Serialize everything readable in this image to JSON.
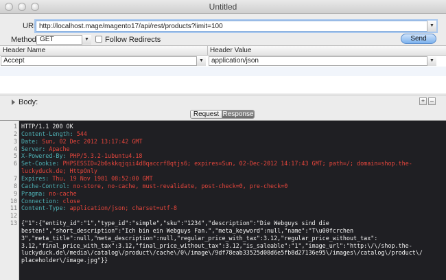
{
  "window": {
    "title": "Untitled"
  },
  "request": {
    "url_label": "URL:",
    "url": "http://localhost.mage/magento17/api/rest/products?limit=100",
    "method_label": "Method:",
    "method": "GET",
    "follow_redirects_label": "Follow Redirects",
    "send_label": "Send"
  },
  "headers_table": {
    "col_name": "Header Name",
    "col_value": "Header Value",
    "rows": [
      {
        "name": "Accept",
        "value": "application/json"
      }
    ]
  },
  "body_section": {
    "label": "Body:",
    "add_label": "+",
    "remove_label": "–"
  },
  "tabs": {
    "request": "Request",
    "response": "Response",
    "active": "Response"
  },
  "response_lines": [
    {
      "n": "1",
      "parts": [
        {
          "t": "HTTP/1.1 200 OK",
          "c": "w"
        }
      ]
    },
    {
      "n": "2",
      "parts": [
        {
          "t": "Content-Length: ",
          "c": "k"
        },
        {
          "t": "544",
          "c": "v"
        }
      ]
    },
    {
      "n": "3",
      "parts": [
        {
          "t": "Date: ",
          "c": "k"
        },
        {
          "t": "Sun, 02 Dec 2012 13:17:42 GMT",
          "c": "v"
        }
      ]
    },
    {
      "n": "4",
      "parts": [
        {
          "t": "Server: ",
          "c": "k"
        },
        {
          "t": "Apache",
          "c": "v"
        }
      ]
    },
    {
      "n": "5",
      "parts": [
        {
          "t": "X-Powered-By: ",
          "c": "k"
        },
        {
          "t": "PHP/5.3.2-1ubuntu4.18",
          "c": "v"
        }
      ]
    },
    {
      "n": "6",
      "parts": [
        {
          "t": "Set-Cookie: ",
          "c": "k"
        },
        {
          "t": "PHPSESSID=2b6skkqjqii4d8qaccrf8qtjs6; expires=Sun, 02-Dec-2012 14:17:43 GMT; path=/; domain=shop.the-",
          "c": "v"
        }
      ]
    },
    {
      "n": "",
      "parts": [
        {
          "t": "luckyduck.de; HttpOnly",
          "c": "v"
        }
      ]
    },
    {
      "n": "7",
      "parts": [
        {
          "t": "Expires: ",
          "c": "k"
        },
        {
          "t": "Thu, 19 Nov 1981 08:52:00 GMT",
          "c": "v"
        }
      ]
    },
    {
      "n": "8",
      "parts": [
        {
          "t": "Cache-Control: ",
          "c": "k"
        },
        {
          "t": "no-store, no-cache, must-revalidate, post-check=0, pre-check=0",
          "c": "v"
        }
      ]
    },
    {
      "n": "9",
      "parts": [
        {
          "t": "Pragma: ",
          "c": "k"
        },
        {
          "t": "no-cache",
          "c": "v"
        }
      ]
    },
    {
      "n": "10",
      "parts": [
        {
          "t": "Connection: ",
          "c": "k"
        },
        {
          "t": "close",
          "c": "v"
        }
      ]
    },
    {
      "n": "11",
      "parts": [
        {
          "t": "Content-Type: ",
          "c": "k"
        },
        {
          "t": "application/json; charset=utf-8",
          "c": "v"
        }
      ]
    },
    {
      "n": "12",
      "parts": [
        {
          "t": "",
          "c": "w"
        }
      ]
    },
    {
      "n": "13",
      "parts": [
        {
          "t": "{\"1\":{\"entity_id\":\"1\",\"type_id\":\"simple\",\"sku\":\"1234\",\"description\":\"Die Webguys sind die",
          "c": "s"
        }
      ]
    },
    {
      "n": "",
      "parts": [
        {
          "t": "besten!\",\"short_description\":\"Ich bin ein Webguys Fan.\",\"meta_keyword\":null,\"name\":\"T\\u00fcrchen",
          "c": "s"
        }
      ]
    },
    {
      "n": "",
      "parts": [
        {
          "t": "3\",\"meta_title\":null,\"meta_description\":null,\"regular_price_with_tax\":3.12,\"regular_price_without_tax\":",
          "c": "s"
        }
      ]
    },
    {
      "n": "",
      "parts": [
        {
          "t": "3.12,\"final_price_with_tax\":3.12,\"final_price_without_tax\":3.12,\"is_saleable\":\"1\",\"image_url\":\"http:\\/\\/shop.the-",
          "c": "s"
        }
      ]
    },
    {
      "n": "",
      "parts": [
        {
          "t": "luckyduck.de\\/media\\/catalog\\/product\\/cache\\/0\\/image\\/9df78eab33525d08d6e5fb8d27136e95\\/images\\/catalog\\/product\\/",
          "c": "s"
        }
      ]
    },
    {
      "n": "",
      "parts": [
        {
          "t": "placeholder\\/image.jpg\"}}",
          "c": "s"
        }
      ]
    }
  ]
}
